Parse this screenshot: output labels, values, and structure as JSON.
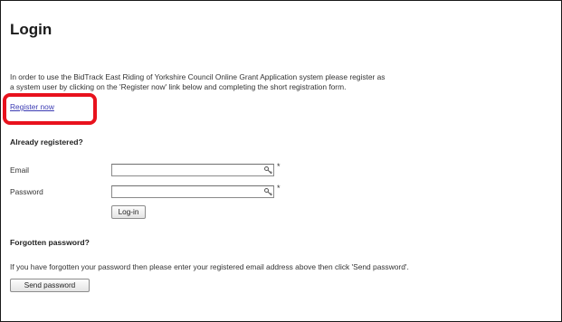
{
  "page": {
    "title": "Login",
    "intro_line1": "In order to use the BidTrack East Riding of Yorkshire Council Online Grant Application system please register as",
    "intro_line2": "a system user by clicking on the 'Register now' link below and completing the short registration form.",
    "register_link": "Register now"
  },
  "login": {
    "heading": "Already registered?",
    "email_label": "Email",
    "email_value": "",
    "password_label": "Password",
    "password_value": "",
    "required_marker": "*",
    "login_button": "Log-in"
  },
  "forgot": {
    "heading": "Forgotten password?",
    "text": "If you have forgotten your password then please enter your registered email address above then click 'Send password'.",
    "send_button": "Send password"
  },
  "colors": {
    "link": "#3b3bb3",
    "highlight": "#e8121d"
  },
  "icons": {
    "field_icon": "key-icon"
  }
}
